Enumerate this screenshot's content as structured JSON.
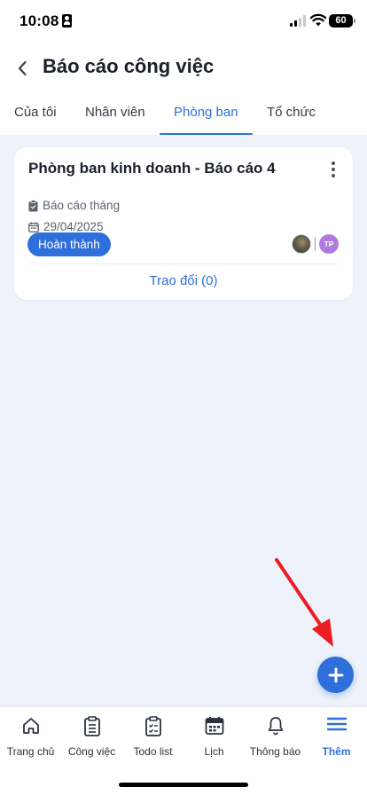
{
  "status_bar": {
    "time": "10:08",
    "battery": "60"
  },
  "header": {
    "title": "Báo cáo công việc"
  },
  "tabs": [
    {
      "label": "Của tôi",
      "active": false
    },
    {
      "label": "Nhân viên",
      "active": false
    },
    {
      "label": "Phòng ban",
      "active": true
    },
    {
      "label": "Tổ chức",
      "active": false
    }
  ],
  "reports": [
    {
      "title": "Phòng ban kinh doanh - Báo cáo 4",
      "type": "Báo cáo tháng",
      "date": "29/04/2025",
      "status": "Hoàn thành",
      "assignee_initials": "TP",
      "discussion_label": "Trao đổi (0)"
    }
  ],
  "bottom_nav": [
    {
      "label": "Trang chủ",
      "icon": "home-icon",
      "active": false
    },
    {
      "label": "Công việc",
      "icon": "task-list-icon",
      "active": false
    },
    {
      "label": "Todo list",
      "icon": "todo-checklist-icon",
      "active": false
    },
    {
      "label": "Lịch",
      "icon": "calendar-icon",
      "active": false
    },
    {
      "label": "Thông báo",
      "icon": "bell-icon",
      "active": false
    },
    {
      "label": "Thêm",
      "icon": "menu-icon",
      "active": true
    }
  ],
  "colors": {
    "accent": "#2f6fdb",
    "background": "#eef3fb",
    "annotation_arrow": "#ee1c24",
    "avatar_initials_bg": "#b07ae0"
  }
}
